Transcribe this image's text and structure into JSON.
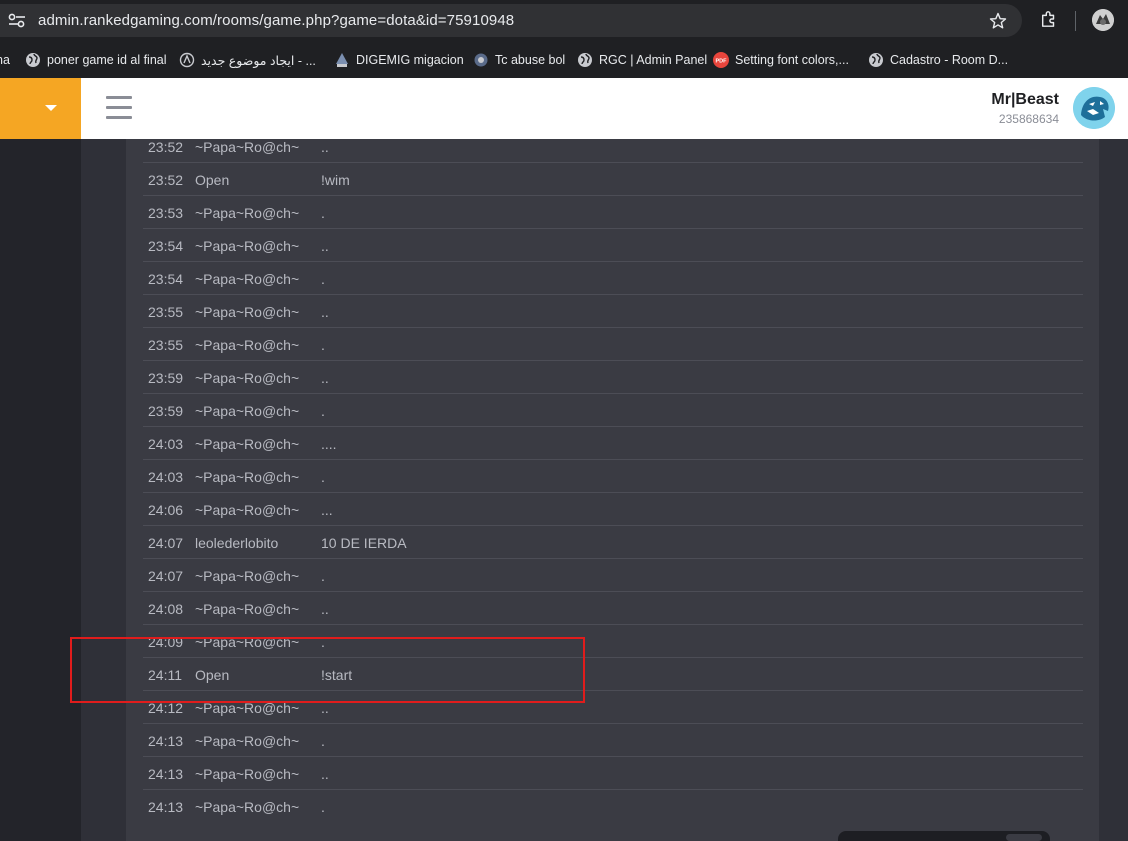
{
  "browser": {
    "url": "admin.rankedgaming.com/rooms/game.php?game=dota&id=75910948"
  },
  "bookmarks": [
    {
      "label": "na",
      "icon": "bookmark-icon"
    },
    {
      "label": "poner game id al final",
      "icon": "globe-icon"
    },
    {
      "label": "ايجاد موضوع جديد - ...",
      "icon": "site-icon"
    },
    {
      "label": "DIGEMIG migacion",
      "icon": "site-icon"
    },
    {
      "label": "Tc abuse bol",
      "icon": "site-icon"
    },
    {
      "label": "RGC | Admin Panel",
      "icon": "globe-icon"
    },
    {
      "label": "Setting font colors,...",
      "icon": "pdf-icon"
    },
    {
      "label": "Cadastro - Room D...",
      "icon": "globe-icon"
    }
  ],
  "header": {
    "username": "Mr|Beast",
    "user_id": "235868634"
  },
  "chat": [
    {
      "time": "23:52",
      "user": "~Papa~Ro@ch~",
      "message": ".."
    },
    {
      "time": "23:52",
      "user": "Open",
      "message": "!wim"
    },
    {
      "time": "23:53",
      "user": "~Papa~Ro@ch~",
      "message": "."
    },
    {
      "time": "23:54",
      "user": "~Papa~Ro@ch~",
      "message": ".."
    },
    {
      "time": "23:54",
      "user": "~Papa~Ro@ch~",
      "message": "."
    },
    {
      "time": "23:55",
      "user": "~Papa~Ro@ch~",
      "message": ".."
    },
    {
      "time": "23:55",
      "user": "~Papa~Ro@ch~",
      "message": "."
    },
    {
      "time": "23:59",
      "user": "~Papa~Ro@ch~",
      "message": ".."
    },
    {
      "time": "23:59",
      "user": "~Papa~Ro@ch~",
      "message": "."
    },
    {
      "time": "24:03",
      "user": "~Papa~Ro@ch~",
      "message": "...."
    },
    {
      "time": "24:03",
      "user": "~Papa~Ro@ch~",
      "message": "."
    },
    {
      "time": "24:06",
      "user": "~Papa~Ro@ch~",
      "message": "..."
    },
    {
      "time": "24:07",
      "user": "leolederlobito",
      "message": "10 DE IERDA"
    },
    {
      "time": "24:07",
      "user": "~Papa~Ro@ch~",
      "message": "."
    },
    {
      "time": "24:08",
      "user": "~Papa~Ro@ch~",
      "message": ".."
    },
    {
      "time": "24:09",
      "user": "~Papa~Ro@ch~",
      "message": "."
    },
    {
      "time": "24:11",
      "user": "Open",
      "message": "!start"
    },
    {
      "time": "24:12",
      "user": "~Papa~Ro@ch~",
      "message": ".."
    },
    {
      "time": "24:13",
      "user": "~Papa~Ro@ch~",
      "message": "."
    },
    {
      "time": "24:13",
      "user": "~Papa~Ro@ch~",
      "message": ".."
    },
    {
      "time": "24:13",
      "user": "~Papa~Ro@ch~",
      "message": "."
    }
  ],
  "colors": {
    "accent": "#f5a623",
    "highlight_border": "#e01c1c"
  }
}
